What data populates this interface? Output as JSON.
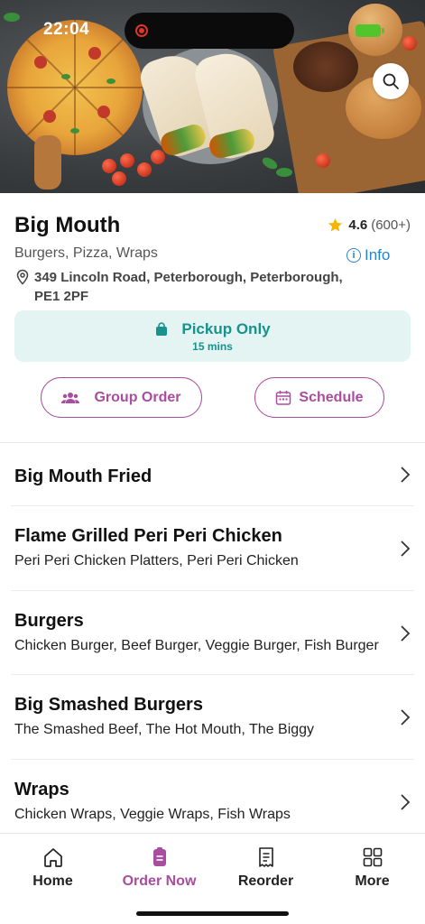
{
  "status_bar": {
    "time": "22:04"
  },
  "restaurant": {
    "name": "Big Mouth",
    "rating": "4.6",
    "rating_count": "(600+)",
    "cuisines": "Burgers, Pizza, Wraps",
    "info_label": "Info",
    "address": "349 Lincoln Road, Peterborough, Peterborough, PE1 2PF"
  },
  "pickup": {
    "label": "Pickup Only",
    "time": "15 mins"
  },
  "actions": {
    "group_order": "Group Order",
    "schedule": "Schedule"
  },
  "categories": [
    {
      "name": "Big Mouth Fried",
      "items": ""
    },
    {
      "name": "Flame Grilled Peri Peri Chicken",
      "items": "Peri Peri Chicken Platters, Peri Peri Chicken"
    },
    {
      "name": "Burgers",
      "items": "Chicken Burger, Beef Burger, Veggie Burger, Fish Burger"
    },
    {
      "name": "Big Smashed Burgers",
      "items": "The Smashed Beef, The Hot Mouth, The Biggy"
    },
    {
      "name": "Wraps",
      "items": "Chicken Wraps, Veggie Wraps, Fish Wraps"
    }
  ],
  "tabs": [
    {
      "label": "Home",
      "icon": "home-icon"
    },
    {
      "label": "Order Now",
      "icon": "order-icon",
      "active": true
    },
    {
      "label": "Reorder",
      "icon": "receipt-icon"
    },
    {
      "label": "More",
      "icon": "grid-icon"
    }
  ],
  "colors": {
    "accent": "#a94d9e",
    "pickup_text": "#18928c",
    "pickup_bg": "#e3f4f3",
    "link": "#2a82c9",
    "star": "#f5b400"
  }
}
